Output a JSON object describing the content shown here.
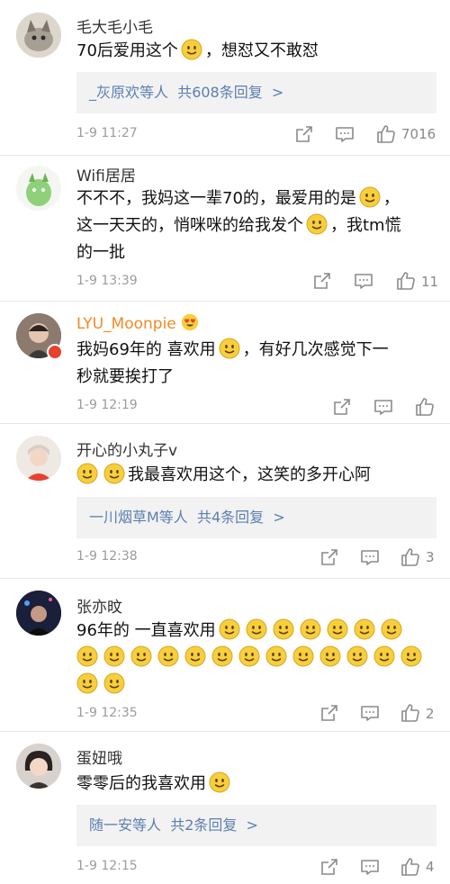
{
  "comments": [
    {
      "username": "毛大毛小毛",
      "text_parts": [
        "70后爱用这个",
        "，想怼又不敢怼"
      ],
      "reply": {
        "prefix": "_灰原欢等人",
        "count": "共608条回复",
        "arrow": ">"
      },
      "time": "1-9 11:27",
      "likes": "7016"
    },
    {
      "username": "Wifi居居",
      "text_parts": [
        "不不不，我妈这一辈70的，最爱用的是",
        "，",
        "这一天天的，悄咪咪的给我发个",
        "，我tm慌",
        "的一批"
      ],
      "time": "1-9 13:39",
      "likes": "11"
    },
    {
      "username": "LYU_Moonpie",
      "text_parts": [
        "我妈69年的 喜欢用",
        "，有好几次感觉下一",
        "秒就要挨打了"
      ],
      "time": "1-9 12:19",
      "likes": ""
    },
    {
      "username": "开心的小丸子v",
      "text_parts": [
        "我最喜欢用这个，这笑的多开心阿"
      ],
      "reply": {
        "prefix": "一川烟草M等人",
        "count": "共4条回复",
        "arrow": ">"
      },
      "time": "1-9 12:38",
      "likes": "3"
    },
    {
      "username": "张亦旼",
      "text_parts": [
        "96年的 一直喜欢用"
      ],
      "time": "1-9 12:35",
      "likes": "2"
    },
    {
      "username": "蛋妞哦",
      "text_parts": [
        "零零后的我喜欢用"
      ],
      "reply": {
        "prefix": "随一安等人",
        "count": "共2条回复",
        "arrow": ">"
      },
      "time": "1-9 12:15",
      "likes": "4"
    }
  ],
  "icons": [
    "share-icon",
    "comment-icon",
    "like-icon",
    "smiley-emoji",
    "heart-eyes-emoji"
  ],
  "colors": {
    "link": "#5b7fb1",
    "username_highlight": "#f08a24",
    "reply_bg": "#f2f2f2",
    "emoji": "#f7cf3d"
  }
}
